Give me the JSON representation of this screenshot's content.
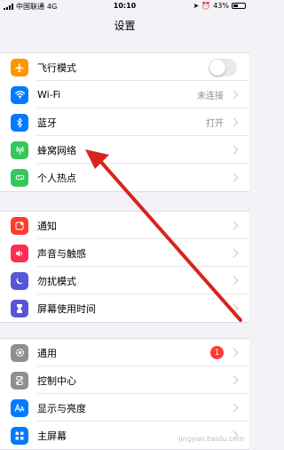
{
  "status_bar": {
    "carrier": "中国联通",
    "network": "4G",
    "time": "10:10",
    "battery": "43%",
    "battery_level": 0.43
  },
  "header": {
    "title": "设置"
  },
  "groups": [
    {
      "items": [
        {
          "label": "飞行模式",
          "icon": "airplane-icon",
          "color": "#ff9500",
          "control": "toggle",
          "toggle_on": false
        },
        {
          "label": "Wi-Fi",
          "icon": "wifi-icon",
          "color": "#007aff",
          "value": "未连接"
        },
        {
          "label": "蓝牙",
          "icon": "bluetooth-icon",
          "color": "#007aff",
          "value": "打开"
        },
        {
          "label": "蜂窝网络",
          "icon": "cellular-antenna-icon",
          "color": "#34c759"
        },
        {
          "label": "个人热点",
          "icon": "hotspot-icon",
          "color": "#34c759"
        }
      ]
    },
    {
      "items": [
        {
          "label": "通知",
          "icon": "notification-icon",
          "color": "#ff3b30"
        },
        {
          "label": "声音与触感",
          "icon": "speaker-icon",
          "color": "#ff2d55"
        },
        {
          "label": "勿扰模式",
          "icon": "moon-icon",
          "color": "#5856d6"
        },
        {
          "label": "屏幕使用时间",
          "icon": "hourglass-icon",
          "color": "#5856d6"
        }
      ]
    },
    {
      "items": [
        {
          "label": "通用",
          "icon": "gear-icon",
          "color": "#8e8e93",
          "badge": "1"
        },
        {
          "label": "控制中心",
          "icon": "control-center-icon",
          "color": "#8e8e93"
        },
        {
          "label": "显示与亮度",
          "icon": "display-aa-icon",
          "color": "#007aff"
        },
        {
          "label": "主屏幕",
          "icon": "home-screen-icon",
          "color": "#007aff"
        }
      ]
    }
  ],
  "annotation": {
    "arrow_color": "#d9231e"
  },
  "watermark": "jingyan.baidu.com"
}
